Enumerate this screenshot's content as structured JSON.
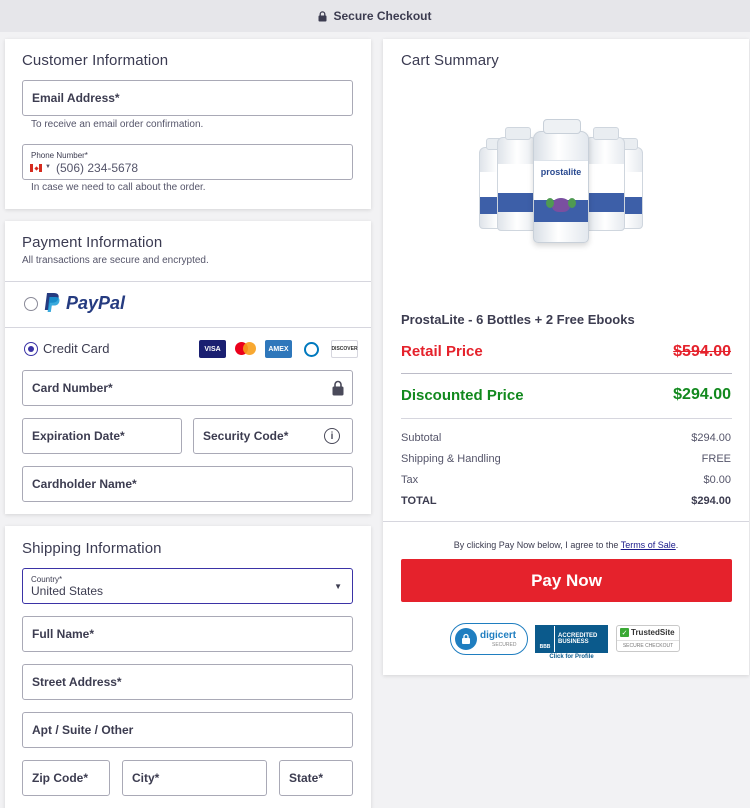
{
  "topbar": {
    "label": "Secure Checkout"
  },
  "customer": {
    "title": "Customer Information",
    "email_label": "Email Address*",
    "email_hint": "To receive an email order confirmation.",
    "phone_small_label": "Phone Number*",
    "phone_placeholder": "(506) 234-5678",
    "phone_hint": "In case we need to call about the order."
  },
  "payment": {
    "title": "Payment Information",
    "subtitle": "All transactions are secure and encrypted.",
    "paypal_label": "PayPal",
    "credit_card_label": "Credit Card",
    "card_brands": [
      "VISA",
      "MC",
      "AMEX",
      "DINERS",
      "DISCOVER"
    ],
    "card_number_label": "Card Number*",
    "expiration_label": "Expiration Date*",
    "security_code_label": "Security Code*",
    "cardholder_label": "Cardholder Name*"
  },
  "shipping": {
    "title": "Shipping Information",
    "country_small_label": "Country*",
    "country_value": "United States",
    "full_name_label": "Full Name*",
    "street_label": "Street Address*",
    "apt_label": "Apt / Suite / Other",
    "zip_label": "Zip Code*",
    "city_label": "City*",
    "state_label": "State*"
  },
  "cart": {
    "title": "Cart Summary",
    "product_name": "ProstaLite - 6 Bottles + 2 Free Ebooks",
    "bottle_brand": "prostalite",
    "retail_label": "Retail Price",
    "retail_price": "$594.00",
    "discount_label": "Discounted Price",
    "discount_price": "$294.00",
    "subtotal_label": "Subtotal",
    "subtotal_value": "$294.00",
    "shipping_label": "Shipping & Handling",
    "shipping_value": "FREE",
    "tax_label": "Tax",
    "tax_value": "$0.00",
    "total_label": "TOTAL",
    "total_value": "$294.00",
    "terms_prefix": "By clicking Pay Now below, I agree to the ",
    "terms_link": "Terms of Sale",
    "terms_suffix": ".",
    "pay_button": "Pay Now"
  },
  "badges": {
    "digicert": "digicert",
    "digicert_sub": "SECURED",
    "bbb_line1": "ACCREDITED",
    "bbb_line2": "BUSINESS",
    "bbb_sub": "Click for Profile",
    "trusted": "TrustedSite",
    "trusted_sub": "SECURE CHECKOUT"
  },
  "colors": {
    "accent_red": "#e5222c",
    "discount_green": "#12891e",
    "radio_selected": "#3b33a6",
    "paypal_dark": "#253b80",
    "paypal_light": "#179bd7"
  }
}
